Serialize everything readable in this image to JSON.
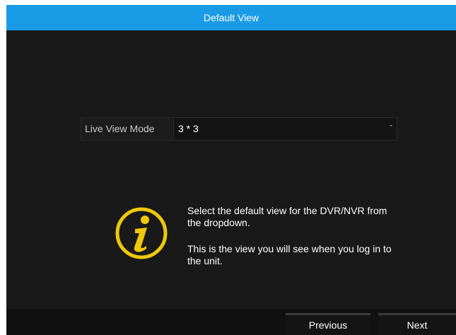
{
  "header": {
    "title": "Default View"
  },
  "form": {
    "live_view_mode_label": "Live View Mode",
    "live_view_mode_value": "3 * 3"
  },
  "info": {
    "icon": "info-icon",
    "accent_color": "#f0c80a",
    "line1": "Select the default view for the DVR/NVR from the dropdown.",
    "line2": "This is the view you will see when you log in to the unit."
  },
  "footer": {
    "previous_label": "Previous",
    "next_label": "Next"
  },
  "colors": {
    "title_bar": "#1a9be6",
    "background": "#191919"
  }
}
